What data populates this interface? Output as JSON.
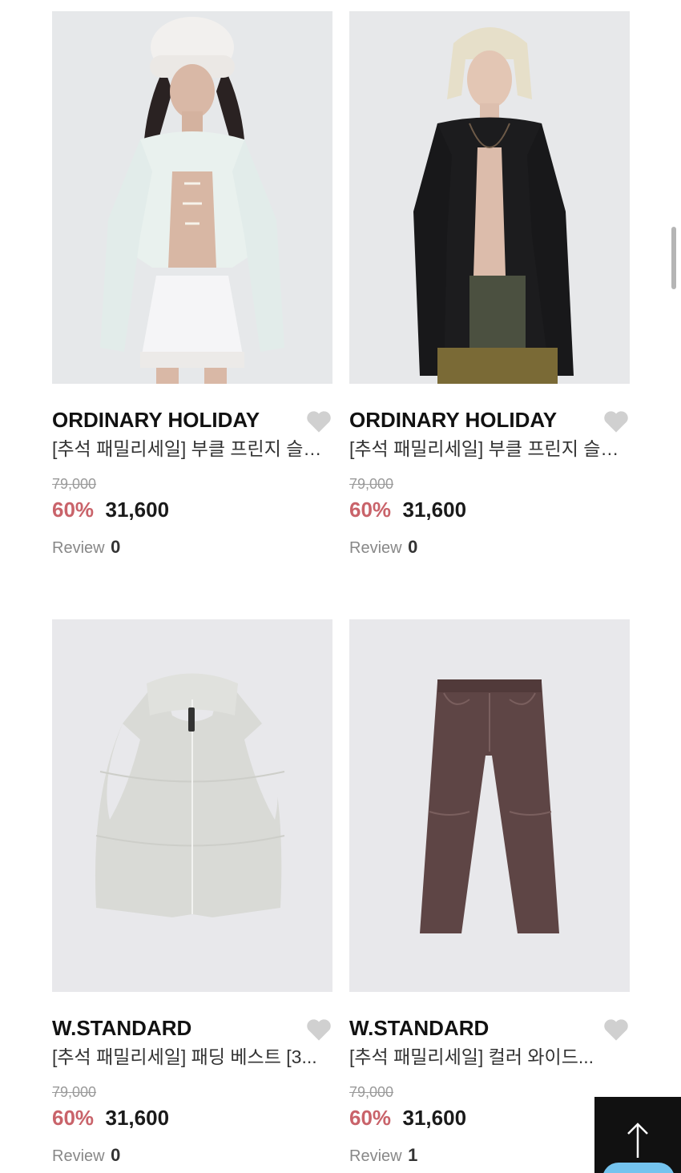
{
  "products": [
    {
      "brand": "ORDINARY HOLIDAY",
      "name": "[추석 패밀리세일] 부클 프린지 슬림...",
      "original_price": "79,000",
      "discount": "60%",
      "price": "31,600",
      "review_label": "Review",
      "review_count": "0",
      "image": "white-cardigan-model"
    },
    {
      "brand": "ORDINARY HOLIDAY",
      "name": "[추석 패밀리세일] 부클 프린지 슬림...",
      "original_price": "79,000",
      "discount": "60%",
      "price": "31,600",
      "review_label": "Review",
      "review_count": "0",
      "image": "black-cardigan-model"
    },
    {
      "brand": "W.STANDARD",
      "name": "[추석 패밀리세일] 패딩 베스트 [3...",
      "original_price": "79,000",
      "discount": "60%",
      "price": "31,600",
      "review_label": "Review",
      "review_count": "0",
      "image": "padded-vest"
    },
    {
      "brand": "W.STANDARD",
      "name": "[추석 패밀리세일] 컬러 와이드...",
      "original_price": "79,000",
      "discount": "60%",
      "price": "31,600",
      "review_label": "Review",
      "review_count": "1",
      "image": "brown-wide-jeans"
    }
  ],
  "colors": {
    "discount": "#c9636a",
    "heart": "#d0d0d0",
    "thumb_bg": "#e9e9ec",
    "top_button_bg": "#111111",
    "chat_accent": "#74c3ee"
  },
  "icons": {
    "wishlist": "heart-icon",
    "scroll_top": "arrow-up-icon"
  }
}
